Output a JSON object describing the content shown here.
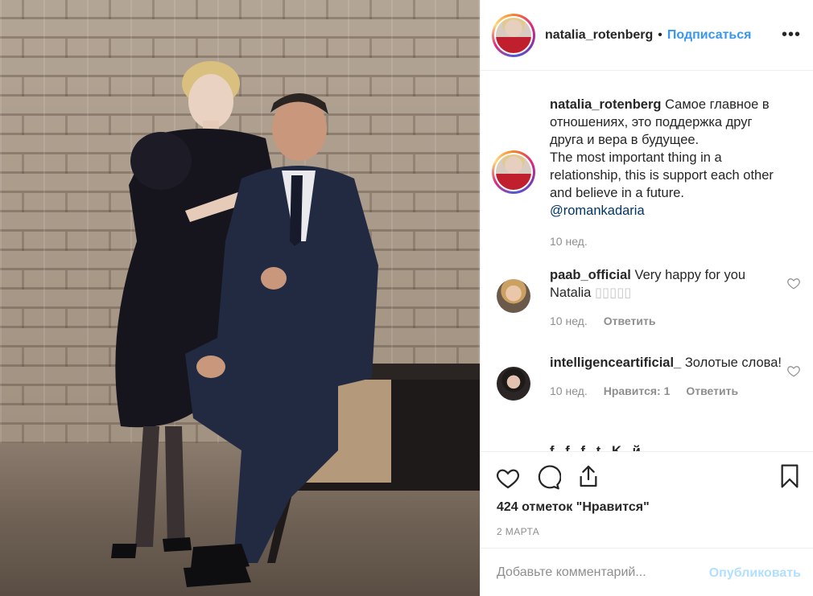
{
  "post": {
    "image_alt": "Фото пары на фоне кирпичной стены",
    "author": "natalia_rotenberg",
    "separator": "•",
    "follow_label": "Подписаться",
    "more_icon": "more-horizontal-icon",
    "caption": {
      "username": "natalia_rotenberg",
      "text_ru": "Самое главное в отношениях, это поддержка друг друга и вера в будущее.",
      "text_en": "The most important thing in a relationship, this is support each other and believe in a future.",
      "mention": "@romankadaria",
      "time": "10 нед."
    },
    "comments": [
      {
        "username": "paab_official",
        "text": "Very happy for you Natalia",
        "emoji_placeholder": "▯▯▯▯▯",
        "time": "10 нед.",
        "reply_label": "Ответить"
      },
      {
        "username": "intelligenceartificial_",
        "text": "Золотые слова!",
        "time": "10 нед.",
        "likes_label": "Нравится: 1",
        "reply_label": "Ответить"
      }
    ],
    "partial_comment": "f...f...f...t...K...й",
    "likes_text": "424 отметок \"Нравится\"",
    "date": "2 МАРТА",
    "comment_placeholder": "Добавьте комментарий...",
    "post_label": "Опубликовать"
  },
  "colors": {
    "link_blue": "#3897f0",
    "mention_blue": "#003569",
    "muted": "#8e8e8e",
    "text": "#262626",
    "post_disabled": "#b2dffc"
  }
}
